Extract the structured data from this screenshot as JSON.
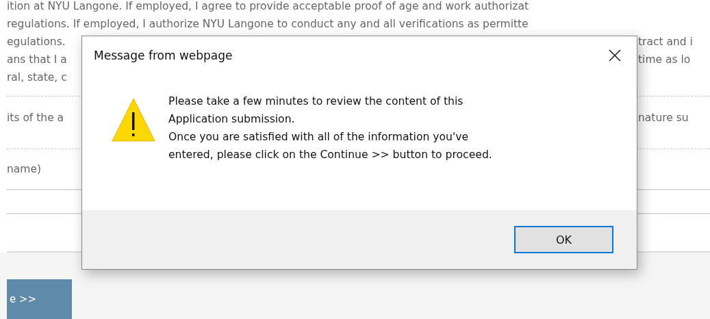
{
  "page": {
    "text_lines": [
      {
        "left": "ition at NYU Langone. If employed, I agree to provide acceptable proof of age and work authorizat"
      },
      {
        "left": "regulations. If employed, I authorize NYU Langone to conduct any and all verifications as permitte"
      },
      {
        "left": "egulations.",
        "right": "tract and i"
      },
      {
        "left": "ans that I a",
        "right": "time as lo"
      },
      {
        "left": "ral, state, c"
      }
    ],
    "consent_line": {
      "left": "its of the a",
      "right": "nature su"
    },
    "name_label": "name)",
    "continue_button": "e >>"
  },
  "dialog": {
    "title": "Message from webpage",
    "message": "Please take a few minutes to review the content of this\nApplication submission.\nOnce you are satisfied with all of the information you've\nentered, please click on the Continue >> button to proceed.",
    "buttons": [
      {
        "label": "OK",
        "focused": true
      }
    ]
  }
}
